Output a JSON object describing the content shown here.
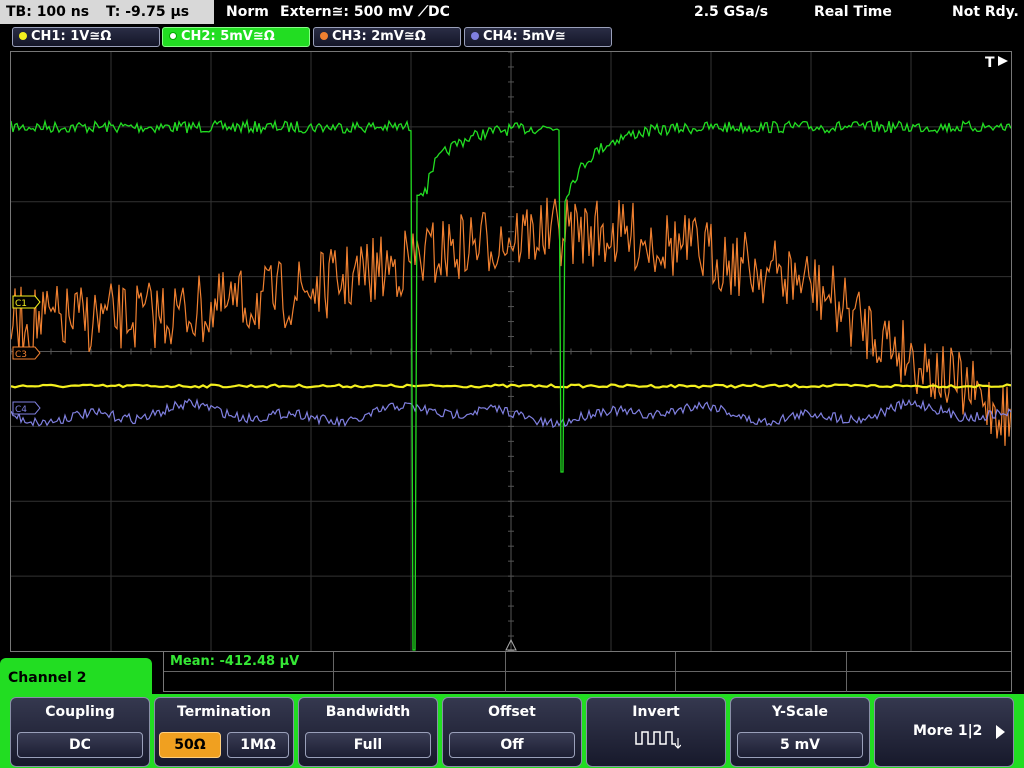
{
  "topbar": {
    "timebase": "TB: 100 ns",
    "trigger_time": "T: -9.75 µs",
    "mode": "Norm",
    "trigger_source": "Extern≅: 500 mV ⟋DC",
    "sample_rate": "2.5 GSa/s",
    "acq_mode": "Real Time",
    "status": "Not Rdy."
  },
  "channels": [
    {
      "label": "CH1: 1V≅Ω",
      "color": "#f4f01e"
    },
    {
      "label": "CH2: 5mV≅Ω",
      "color": "#22dd22"
    },
    {
      "label": "CH3: 2mV≅Ω",
      "color": "#f08030"
    },
    {
      "label": "CH4: 5mV≅",
      "color": "#8080e0"
    }
  ],
  "markers": {
    "trigger": "T",
    "c1": "C1",
    "c3": "C3",
    "c4": "C4"
  },
  "measurement": {
    "mean": "Mean: -412.48 µV"
  },
  "menu": {
    "title": "Channel 2",
    "coupling": {
      "title": "Coupling",
      "value": "DC"
    },
    "termination": {
      "title": "Termination",
      "opt1": "50Ω",
      "opt2": "1MΩ"
    },
    "bandwidth": {
      "title": "Bandwidth",
      "value": "Full"
    },
    "offset": {
      "title": "Offset",
      "value": "Off"
    },
    "invert": {
      "title": "Invert",
      "icon": "invert-waveform-icon"
    },
    "yscale": {
      "title": "Y-Scale",
      "value": "5 mV"
    },
    "more": {
      "label": "More 1|2"
    }
  }
}
